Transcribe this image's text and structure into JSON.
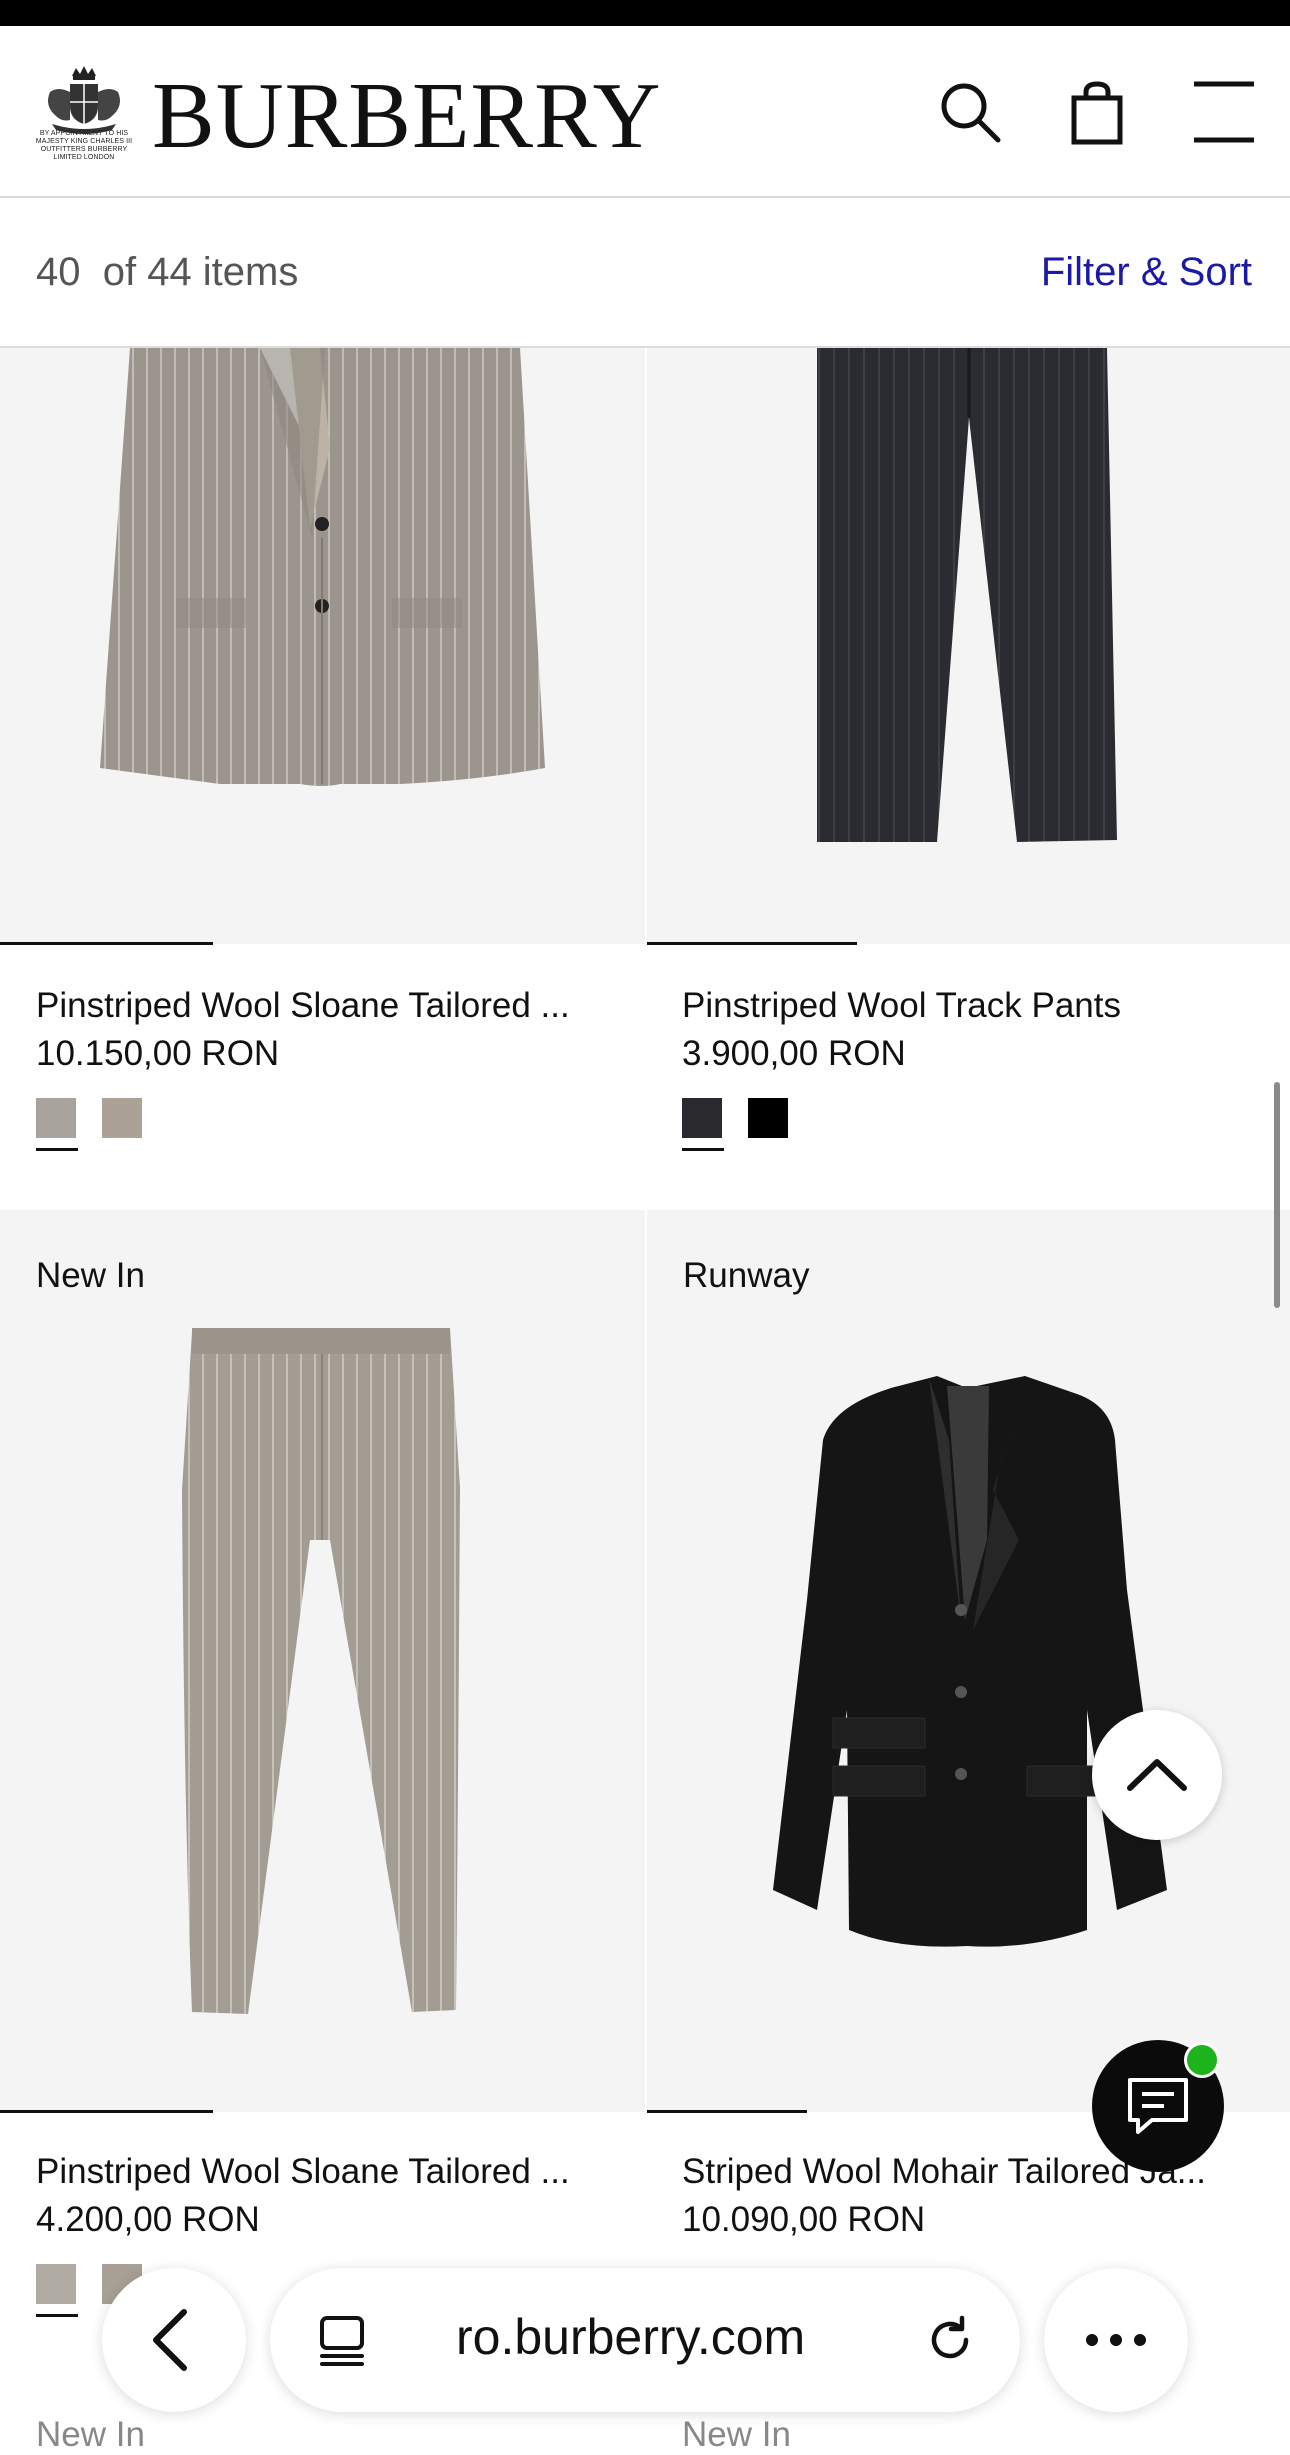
{
  "header": {
    "brand": "BURBERRY",
    "warrant_text": "BY APPOINTMENT TO HIS MAJESTY KING CHARLES III OUTFITTERS BURBERRY LIMITED LONDON",
    "icons": [
      "royal-crest-icon",
      "search-icon",
      "shopping-bag-icon",
      "menu-icon"
    ]
  },
  "results": {
    "count_text": "40  of 44 items",
    "filter_sort": "Filter & Sort"
  },
  "products": [
    {
      "tag": "",
      "name": "Pinstriped Wool Sloane Tailored ...",
      "price": "10.150,00 RON",
      "swatches": [
        "#a8a49d",
        "#aca196"
      ],
      "image": "jacket-grey-pinstripe"
    },
    {
      "tag": "",
      "name": "Pinstriped Wool Track Pants",
      "price": "3.900,00 RON",
      "swatches": [
        "#2a2a2e",
        "#000000"
      ],
      "image": "trousers-charcoal-pinstripe"
    },
    {
      "tag": "New In",
      "name": "Pinstriped Wool Sloane Tailored ...",
      "price": "4.200,00 RON",
      "swatches": [
        "#b0aca4",
        "#a9a095"
      ],
      "image": "trousers-grey-pinstripe"
    },
    {
      "tag": "Runway",
      "name": "Striped Wool Mohair Tailored Ja...",
      "price": "10.090,00 RON",
      "swatches": [],
      "image": "jacket-black"
    }
  ],
  "next_row_tags": [
    "New In",
    "New In"
  ],
  "browser": {
    "url": "ro.burberry.com",
    "icons": [
      "back-icon",
      "tabs-icon",
      "reload-icon",
      "more-icon"
    ]
  },
  "floating": {
    "icons": [
      "chevron-up-icon",
      "chat-icon"
    ],
    "chat_status_color": "#1db31d"
  },
  "colors": {
    "link": "#1a1aa6",
    "tile_background": "#f4f4f4"
  }
}
